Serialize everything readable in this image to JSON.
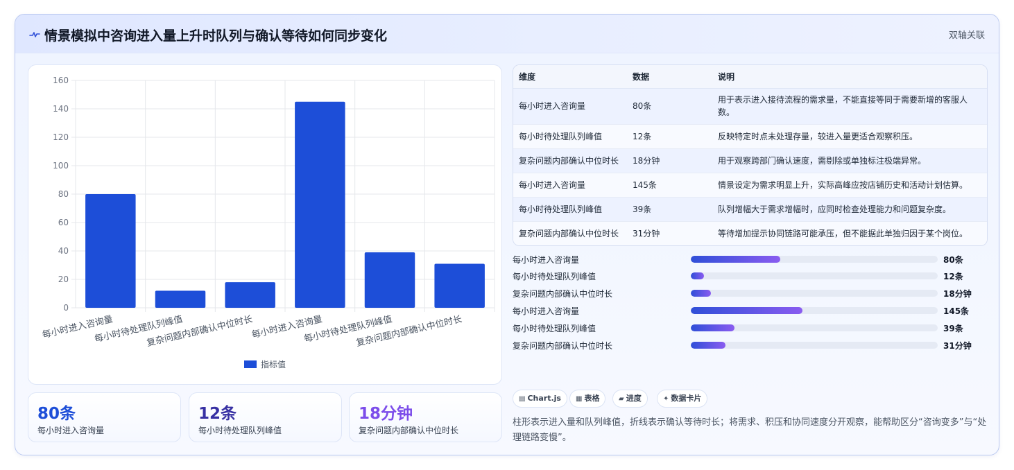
{
  "header": {
    "title": "情景模拟中咨询进入量上升时队列与确认等待如何同步变化",
    "tag": "双轴关联"
  },
  "chart_data": {
    "type": "bar",
    "categories": [
      "每小时进入咨询量",
      "每小时待处理队列峰值",
      "复杂问题内部确认中位时长",
      "每小时进入咨询量",
      "每小时待处理队列峰值",
      "复杂问题内部确认中位时长"
    ],
    "series": [
      {
        "name": "指标值",
        "values": [
          80,
          12,
          18,
          145,
          39,
          31
        ]
      }
    ],
    "ylim": [
      0,
      160
    ],
    "yticks": [
      "0",
      "20",
      "40",
      "60",
      "80",
      "100",
      "120",
      "140",
      "160"
    ],
    "grid": true,
    "legend": "bottom",
    "bar_color": "#1d4ed8"
  },
  "kpis": [
    {
      "value": "80条",
      "label": "每小时进入咨询量",
      "color": "#1d4ed8"
    },
    {
      "value": "12条",
      "label": "每小时待处理队列峰值",
      "color": "#3730a3"
    },
    {
      "value": "18分钟",
      "label": "复杂问题内部确认中位时长",
      "color": "#7c4dea"
    }
  ],
  "table": {
    "headers": [
      "维度",
      "数据",
      "说明"
    ],
    "rows": [
      {
        "dim": "每小时进入咨询量",
        "data": "80条",
        "desc": "用于表示进入接待流程的需求量，不能直接等同于需要新增的客服人数。"
      },
      {
        "dim": "每小时待处理队列峰值",
        "data": "12条",
        "desc": "反映特定时点未处理存量，较进入量更适合观察积压。"
      },
      {
        "dim": "复杂问题内部确认中位时长",
        "data": "18分钟",
        "desc": "用于观察跨部门确认速度，需剔除或单独标注极端异常。"
      },
      {
        "dim": "每小时进入咨询量",
        "data": "145条",
        "desc": "情景设定为需求明显上升，实际高峰应按店铺历史和活动计划估算。"
      },
      {
        "dim": "每小时待处理队列峰值",
        "data": "39条",
        "desc": "队列增幅大于需求增幅时，应同时检查处理能力和问题复杂度。"
      },
      {
        "dim": "复杂问题内部确认中位时长",
        "data": "31分钟",
        "desc": "等待增加提示协同链路可能承压，但不能据此单独归因于某个岗位。"
      }
    ]
  },
  "progress": [
    {
      "label": "每小时进入咨询量",
      "value": "80条",
      "fraction": 0.363
    },
    {
      "label": "每小时待处理队列峰值",
      "value": "12条",
      "fraction": 0.054
    },
    {
      "label": "复杂问题内部确认中位时长",
      "value": "18分钟",
      "fraction": 0.082
    },
    {
      "label": "每小时进入咨询量",
      "value": "145条",
      "fraction": 0.452
    },
    {
      "label": "每小时待处理队列峰值",
      "value": "39条",
      "fraction": 0.177
    },
    {
      "label": "复杂问题内部确认中位时长",
      "value": "31分钟",
      "fraction": 0.141
    }
  ],
  "chips": [
    {
      "icon": "▤",
      "label": "Chart.js",
      "icon_name": "chart-icon"
    },
    {
      "icon": "▦",
      "label": "表格",
      "icon_name": "table-icon"
    },
    {
      "icon": "▰",
      "label": "进度",
      "icon_name": "progress-icon"
    },
    {
      "icon": "✦",
      "label": "数据卡片",
      "icon_name": "sparkle-icon"
    }
  ],
  "note": "柱形表示进入量和队列峰值，折线表示确认等待时长；将需求、积压和协同速度分开观察，能帮助区分“咨询变多”与“处理链路变慢”。"
}
